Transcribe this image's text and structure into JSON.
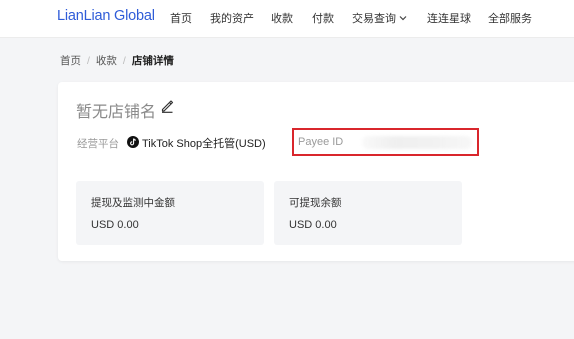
{
  "header": {
    "brand": "LianLian Global",
    "nav": [
      {
        "label": "首页"
      },
      {
        "label": "我的资产"
      },
      {
        "label": "收款"
      },
      {
        "label": "付款"
      },
      {
        "label": "交易查询"
      },
      {
        "label": "连连星球"
      },
      {
        "label": "全部服务"
      }
    ]
  },
  "breadcrumb": {
    "items": [
      "首页",
      "收款",
      "店铺详情"
    ]
  },
  "store": {
    "name": "暂无店铺名",
    "platform_label": "经营平台",
    "platform_value": "TikTok Shop全托管(USD)",
    "payee_label": "Payee ID"
  },
  "balances": [
    {
      "title": "提现及监测中金额",
      "value": "USD 0.00"
    },
    {
      "title": "可提现余额",
      "value": "USD 0.00"
    }
  ],
  "colors": {
    "brand": "#2f5cd8",
    "highlight_box": "#d9262c",
    "page_bg": "#f4f5f7"
  },
  "icons": {
    "edit": "pencil-icon",
    "platform": "tiktok-icon",
    "dropdown": "chevron-down-icon"
  }
}
